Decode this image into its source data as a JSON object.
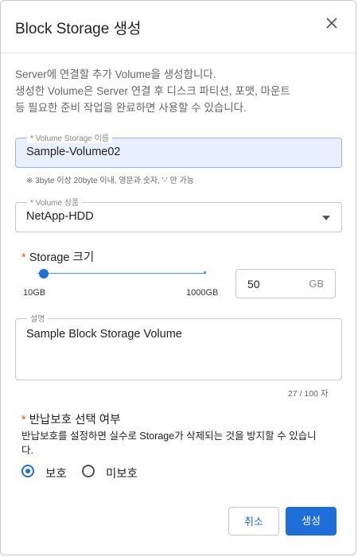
{
  "dialog": {
    "title": "Block Storage 생성",
    "close_icon": "close-icon"
  },
  "description": {
    "line1": "Server에 연결할 추가 Volume을 생성합니다.",
    "line2": "생성한 Volume은 Server 연결 후 디스크 파티션, 포맷, 마운트",
    "line3": "등 필요한 준비 작업을 완료하면 사용할 수 있습니다."
  },
  "volume_name": {
    "required_mark": "*",
    "label": "Volume Storage 이름",
    "value": "Sample-Volume02",
    "hint": "※ 3byte 이상 20byte 이내, 영문과 숫자, '-' 만 가능"
  },
  "volume_type": {
    "required_mark": "*",
    "label": "Volume 상품",
    "selected": "NetApp-HDD",
    "caret_icon": "caret-down-icon"
  },
  "storage_size": {
    "required_mark": "*",
    "label": "Storage 크기",
    "slider_min": "10GB",
    "slider_max": "1000GB",
    "value": "50",
    "unit": "GB",
    "slider_fraction": 0.04
  },
  "description_field": {
    "label": "설명",
    "value": "Sample Block Storage Volume",
    "counter": "27 / 100 자"
  },
  "protection": {
    "required_mark": "*",
    "label": "반납보호 선택 여부",
    "desc": "반납보호를 설정하면 실수로 Storage가 삭제되는 것을 방지할 수 있습니다.",
    "options": [
      {
        "label": "보호",
        "selected": true
      },
      {
        "label": "미보호",
        "selected": false
      }
    ]
  },
  "buttons": {
    "cancel": "취소",
    "create": "생성"
  },
  "colors": {
    "accent": "#1e6fd9",
    "required": "#e05a1b",
    "autofill_bg": "#e8f0fe"
  }
}
